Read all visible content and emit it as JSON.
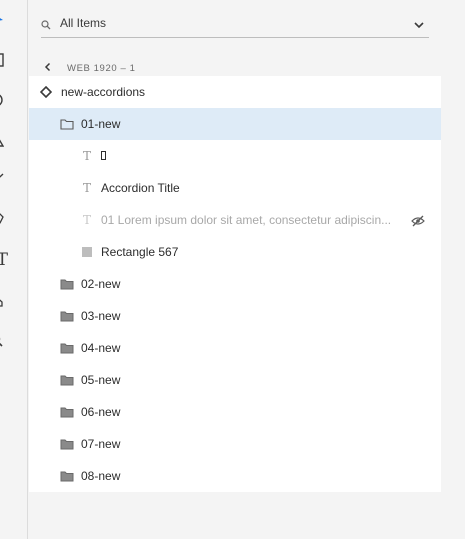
{
  "search": {
    "placeholder": "All Items"
  },
  "breadcrumb": {
    "label": "WEB 1920 – 1"
  },
  "layers": {
    "root": {
      "name": "new-accordions"
    },
    "open_group": {
      "name": "01-new",
      "children": [
        {
          "name": "",
          "type": "text"
        },
        {
          "name": "Accordion Title",
          "type": "text"
        },
        {
          "name": "01 Lorem ipsum dolor sit amet, consectetur adipiscin...",
          "type": "text",
          "hidden": true
        },
        {
          "name": "Rectangle 567",
          "type": "rectangle"
        }
      ]
    },
    "groups": [
      {
        "name": "02-new"
      },
      {
        "name": "03-new"
      },
      {
        "name": "04-new"
      },
      {
        "name": "05-new"
      },
      {
        "name": "06-new"
      },
      {
        "name": "07-new"
      },
      {
        "name": "08-new"
      }
    ]
  },
  "toolbar": {
    "tools": [
      "select-icon",
      "rectangle-icon",
      "ellipse-icon",
      "polygon-icon",
      "line-icon",
      "pen-icon",
      "text-icon",
      "artboard-icon",
      "zoom-icon"
    ],
    "text_tool_glyph": "T"
  },
  "colors": {
    "selected_row": "#deebf7",
    "accent": "#1473e6"
  }
}
